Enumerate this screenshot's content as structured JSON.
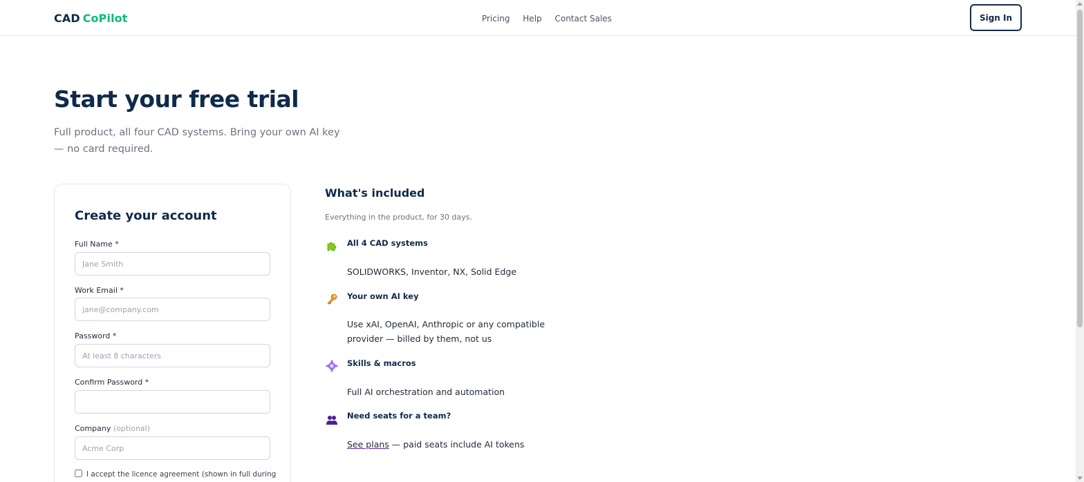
{
  "header": {
    "logo_part1": "CAD",
    "logo_part2": "CoPilot",
    "nav": [
      "Pricing",
      "Help",
      "Contact Sales"
    ],
    "sign_in": "Sign In"
  },
  "hero": {
    "title": "Start your free trial",
    "subtitle": "Full product, all four CAD systems. Bring your own AI key — no card required."
  },
  "form": {
    "title": "Create your account",
    "fields": [
      {
        "label": "Full Name *",
        "placeholder": "Jane Smith"
      },
      {
        "label": "Work Email *",
        "placeholder": "jane@company.com"
      },
      {
        "label": "Password *",
        "placeholder": "At least 8 characters"
      },
      {
        "label": "Confirm Password *",
        "placeholder": ""
      },
      {
        "label": "Company",
        "optional": "(optional)",
        "placeholder": "Acme Corp"
      }
    ],
    "agree_text": "I accept the licence agreement (shown in full during"
  },
  "included": {
    "title": "What's included",
    "subtitle": "Everything in the product, for 30 days.",
    "features": [
      {
        "icon": "puzzle-icon",
        "title": "All 4 CAD systems",
        "desc": "SOLIDWORKS, Inventor, NX, Solid Edge"
      },
      {
        "icon": "key-icon",
        "title": "Your own AI key",
        "desc": "Use xAI, OpenAI, Anthropic or any compatible provider — billed by them, not us"
      },
      {
        "icon": "gear-icon",
        "title": "Skills & macros",
        "desc": "Full AI orchestration and automation"
      },
      {
        "icon": "team-icon",
        "title": "Need seats for a team?",
        "link": "See plans",
        "desc_rest": " — paid seats include AI tokens"
      }
    ]
  },
  "colors": {
    "brand_navy": "#0f2a4a",
    "brand_green": "#10b981",
    "link_underline": "#6b21a8"
  }
}
